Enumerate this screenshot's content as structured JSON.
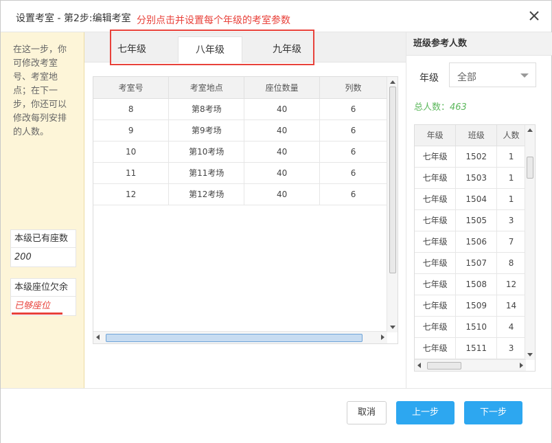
{
  "dialog": {
    "title": "设置考室 - 第2步:编辑考室",
    "annotation": "分别点击并设置每个年级的考室参数"
  },
  "left_panel": {
    "hint": "在这一步，你可修改考室号、考室地点；在下一步，你还可以修改每列安排的人数。",
    "seats_label": "本级已有座数",
    "seats_value": "200",
    "shortage_label": "本级座位欠余",
    "shortage_value": "已够座位"
  },
  "tabs": [
    {
      "label": "七年级",
      "active": false
    },
    {
      "label": "八年级",
      "active": true
    },
    {
      "label": "九年级",
      "active": false
    }
  ],
  "rooms_table": {
    "headers": [
      "考室号",
      "考室地点",
      "座位数量",
      "列数"
    ],
    "rows": [
      [
        "8",
        "第8考场",
        "40",
        "6"
      ],
      [
        "9",
        "第9考场",
        "40",
        "6"
      ],
      [
        "10",
        "第10考场",
        "40",
        "6"
      ],
      [
        "11",
        "第11考场",
        "40",
        "6"
      ],
      [
        "12",
        "第12考场",
        "40",
        "6"
      ]
    ]
  },
  "right_panel": {
    "title": "班级参考人数",
    "grade_label": "年级",
    "grade_select": "全部",
    "total_label": "总人数：",
    "total_value": "463",
    "headers": [
      "年级",
      "班级",
      "人数"
    ],
    "rows": [
      [
        "七年级",
        "1502",
        "1"
      ],
      [
        "七年级",
        "1503",
        "1"
      ],
      [
        "七年级",
        "1504",
        "1"
      ],
      [
        "七年级",
        "1505",
        "3"
      ],
      [
        "七年级",
        "1506",
        "7"
      ],
      [
        "七年级",
        "1507",
        "8"
      ],
      [
        "七年级",
        "1508",
        "12"
      ],
      [
        "七年级",
        "1509",
        "14"
      ],
      [
        "七年级",
        "1510",
        "4"
      ],
      [
        "七年级",
        "1511",
        "3"
      ]
    ]
  },
  "footer": {
    "cancel": "取消",
    "prev": "上一步",
    "next": "下一步"
  },
  "colors": {
    "accent": "#2da7f0",
    "annotation_red": "#e8413a",
    "total_green": "#5cb85c",
    "sidebar_bg": "#fdf5d8"
  },
  "icons": {
    "close": "close-icon"
  }
}
